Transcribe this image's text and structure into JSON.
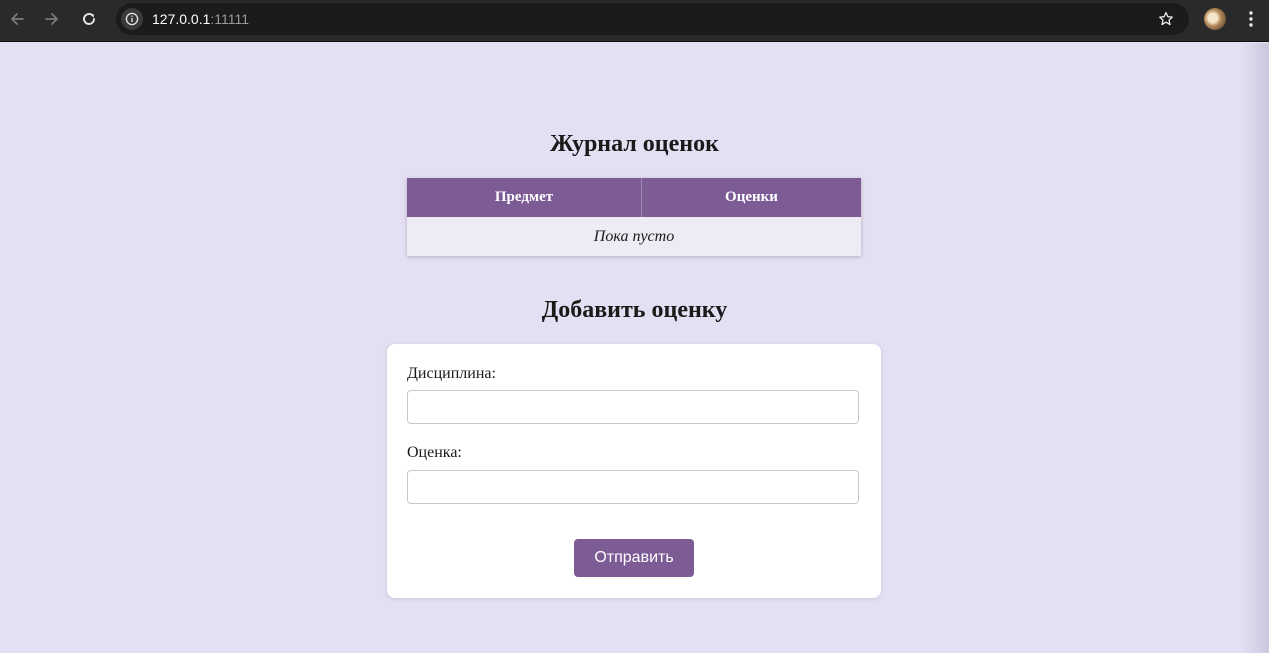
{
  "browser": {
    "url_host": "127.0.0.1",
    "url_port": ":11111",
    "icons": {
      "back": "arrow-left-icon",
      "forward": "arrow-right-icon",
      "reload": "reload-icon",
      "site_info": "info-icon",
      "bookmark": "star-icon",
      "profile": "avatar",
      "menu": "kebab-menu-icon"
    }
  },
  "page": {
    "background_color": "#e4dff2",
    "accent_color": "#7d5c96",
    "journal_title": "Журнал оценок",
    "table": {
      "headers": [
        "Предмет",
        "Оценки"
      ],
      "empty_text": "Пока пусто"
    },
    "form": {
      "title": "Добавить оценку",
      "discipline_label": "Дисциплина:",
      "discipline_value": "",
      "grade_label": "Оценка:",
      "grade_value": "",
      "submit_label": "Отправить"
    }
  }
}
